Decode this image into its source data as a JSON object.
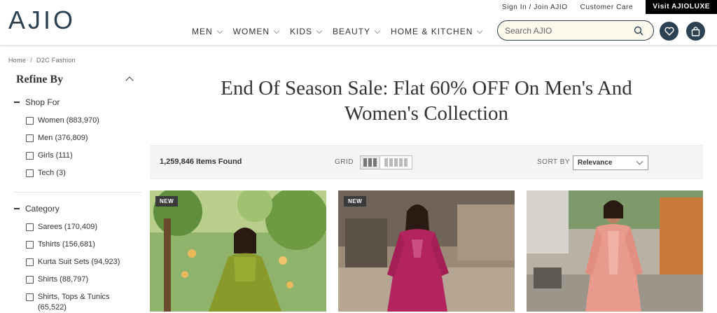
{
  "header": {
    "logo": "AJIO",
    "top_links": {
      "signin": "Sign In / Join AJIO",
      "care": "Customer Care",
      "luxe": "Visit AJIOLUXE"
    },
    "nav": [
      "MEN",
      "WOMEN",
      "KIDS",
      "BEAUTY",
      "HOME & KITCHEN"
    ],
    "search_placeholder": "Search AJIO"
  },
  "breadcrumb": {
    "home": "Home",
    "sep": "/",
    "current": "D2C Fashion"
  },
  "sidebar": {
    "title": "Refine By",
    "shop_for": {
      "heading": "Shop For",
      "options": [
        "Women (883,970)",
        "Men (376,809)",
        "Girls (111)",
        "Tech (3)"
      ]
    },
    "category": {
      "heading": "Category",
      "options": [
        "Sarees (170,409)",
        "Tshirts (156,681)",
        "Kurta Suit Sets (94,923)",
        "Shirts (88,797)",
        "Shirts, Tops & Tunics",
        "(65,522)"
      ]
    }
  },
  "main": {
    "title_line1": "End Of Season Sale: Flat 60% OFF On Men's And",
    "title_line2": "Women's Collection",
    "items_found": "1,259,846 Items Found",
    "grid_label": "GRID",
    "sort_label": "SORT BY",
    "sort_value": "Relevance"
  },
  "products": [
    {
      "badge": "NEW"
    },
    {
      "badge": "NEW"
    },
    {
      "badge": ""
    }
  ],
  "colors": {
    "brand": "#2c4152",
    "search_bg": "#fbf8ec",
    "luxe_bg": "#000000"
  }
}
